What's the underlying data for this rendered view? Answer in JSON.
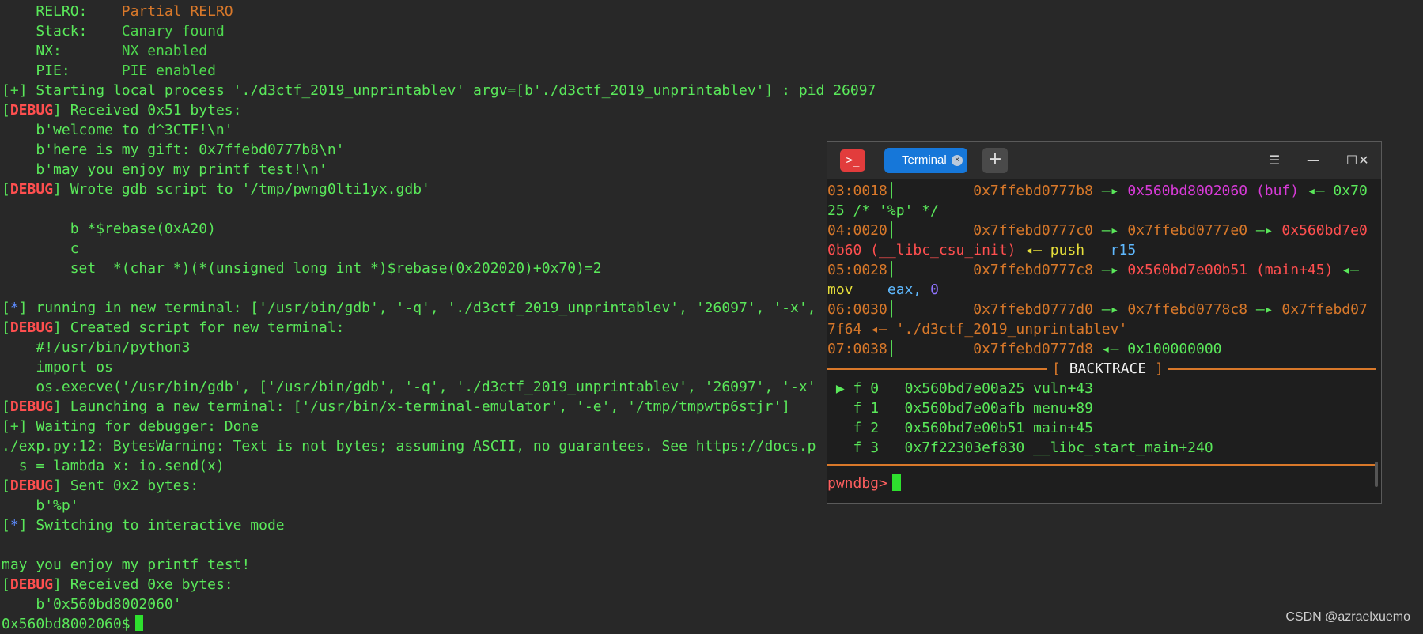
{
  "terminal": {
    "relro_key": "RELRO:",
    "relro_value": "Partial RELRO",
    "stack_key": "Stack:",
    "stack_value": "Canary found",
    "nx_key": "NX:",
    "nx_value": "NX enabled",
    "pie_key": "PIE:",
    "pie_value": "PIE enabled",
    "starting_process": "Starting local process './d3ctf_2019_unprintablev' argv=[b'./d3ctf_2019_unprintablev'] : pid 26097",
    "received_1": "Received 0x51 bytes:",
    "welcome": "b'welcome to d^3CTF!\\n'",
    "gift": "b'here is my gift: 0x7ffebd0777b8\\n'",
    "enjoy": "b'may you enjoy my printf test!\\n'",
    "wrote_gdb": "Wrote gdb script to '/tmp/pwng0lti1yx.gdb'",
    "gdb_b": "b *$rebase(0xA20)",
    "gdb_c": "c",
    "gdb_set": "set  *(char *)(*(unsigned long int *)$rebase(0x202020)+0x70)=2",
    "running_new_terminal": "running in new terminal: ['/usr/bin/gdb', '-q', './d3ctf_2019_unprintablev', '26097', '-x',",
    "created_script": "Created script for new terminal:",
    "shebang": "#!/usr/bin/python3",
    "import_os": "import os",
    "execve": "os.execve('/usr/bin/gdb', ['/usr/bin/gdb', '-q', './d3ctf_2019_unprintablev', '26097', '-x'",
    "launching": "Launching a new terminal: ['/usr/bin/x-terminal-emulator', '-e', '/tmp/tmpwtp6stjr']",
    "waiting": "Waiting for debugger: Done",
    "bytes_warning": "./exp.py:12: BytesWarning: Text is not bytes; assuming ASCII, no guarantees. See https://docs.p",
    "lambda": "s = lambda x: io.send(x)",
    "sent": "Sent 0x2 bytes:",
    "sent_payload": "b'%p'",
    "switching": "Switching to interactive mode",
    "enjoy_plain": "may you enjoy my printf test!",
    "received_2": "Received 0xe bytes:",
    "received_payload": "b'0x560bd8002060'",
    "prompt": "0x560bd8002060$"
  },
  "markers": {
    "plus": "+",
    "star": "*",
    "debug": "DEBUG"
  },
  "window": {
    "app_icon": ">_",
    "tab_label": "Terminal",
    "tab_close": "×",
    "new_tab": "+",
    "menu": "☰",
    "minimize": "—",
    "maximize": "☐",
    "close": "✕"
  },
  "gdb": {
    "stack_lines": [
      {
        "idx": "03:0018",
        "addr": "0x7ffebd0777b8",
        "arrow": "—▸",
        "val": "0x560bd8002060",
        "sym": "(buf)",
        "tail": "◂— 0x70"
      },
      {
        "cont": "25 /* '%p' */"
      },
      {
        "idx": "04:0020",
        "addr": "0x7ffebd0777c0",
        "arrow": "—▸",
        "val": "0x7ffebd0777e0",
        "arrow2": "—▸",
        "val2": "0x560bd7e0"
      },
      {
        "cont": "0b60 (__libc_csu_init)",
        "tail": "◂— push",
        "reg": "r15"
      },
      {
        "idx": "05:0028",
        "addr": "0x7ffebd0777c8",
        "arrow": "—▸",
        "val": "0x560bd7e00b51 (main+45)",
        "tail": "◂—"
      },
      {
        "cont_mov": "mov",
        "reg": "eax,",
        "num": "0"
      },
      {
        "idx": "06:0030",
        "addr": "0x7ffebd0777d0",
        "arrow": "—▸",
        "val": "0x7ffebd0778c8",
        "arrow2": "—▸",
        "val2": "0x7ffebd07"
      },
      {
        "cont": "7f64 ◂— './d3ctf_2019_unprintablev'"
      },
      {
        "idx": "07:0038",
        "addr": "0x7ffebd0777d8",
        "tail": "◂— 0x100000000"
      }
    ],
    "backtrace_title": "BACKTRACE",
    "frames": [
      {
        "marker": "▶",
        "frame": "f 0",
        "addr": "0x560bd7e00a25",
        "sym": "vuln+43"
      },
      {
        "marker": "",
        "frame": "f 1",
        "addr": "0x560bd7e00afb",
        "sym": "menu+89"
      },
      {
        "marker": "",
        "frame": "f 2",
        "addr": "0x560bd7e00b51",
        "sym": "main+45"
      },
      {
        "marker": "",
        "frame": "f 3",
        "addr": "0x7f22303ef830",
        "sym": "__libc_start_main+240"
      }
    ],
    "prompt": "pwndbg>"
  },
  "watermark": "CSDN @azraelxuemo",
  "colors": {
    "background": "#282828",
    "green": "#5ae85a",
    "orange": "#d8782a",
    "red": "#ff4f4f",
    "blue": "#5c8cff",
    "magenta": "#d83bd8",
    "cyan": "#5fb9ff",
    "tab_blue": "#1677d9"
  }
}
